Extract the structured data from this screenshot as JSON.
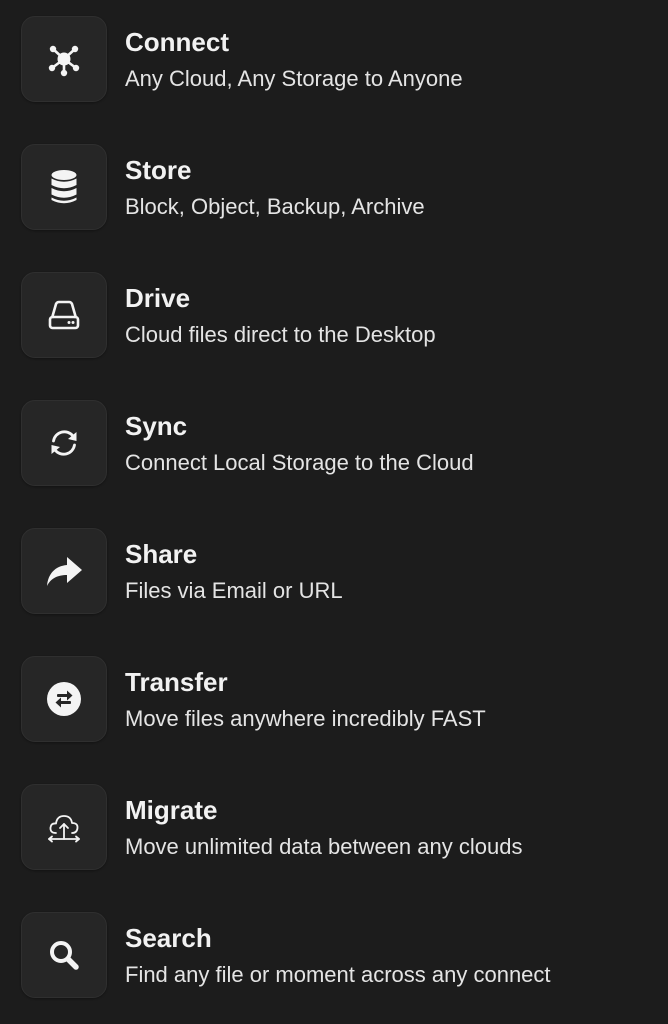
{
  "menu": {
    "items": [
      {
        "icon": "network-hub-icon",
        "title": "Connect",
        "subtitle": "Any Cloud, Any Storage to Anyone"
      },
      {
        "icon": "database-icon",
        "title": "Store",
        "subtitle": "Block, Object, Backup, Archive"
      },
      {
        "icon": "hard-drive-icon",
        "title": "Drive",
        "subtitle": "Cloud files direct to the Desktop"
      },
      {
        "icon": "sync-arrows-icon",
        "title": "Sync",
        "subtitle": "Connect Local Storage to the Cloud"
      },
      {
        "icon": "share-arrow-icon",
        "title": "Share",
        "subtitle": "Files via Email or URL"
      },
      {
        "icon": "transfer-exchange-icon",
        "title": "Transfer",
        "subtitle": "Move files anywhere incredibly FAST"
      },
      {
        "icon": "cloud-upload-icon",
        "title": "Migrate",
        "subtitle": "Move unlimited data between any clouds"
      },
      {
        "icon": "search-icon",
        "title": "Search",
        "subtitle": "Find any file or moment across any connect"
      }
    ]
  },
  "colors": {
    "background": "#1c1c1c",
    "tile": "#262626",
    "icon": "#f4f4f4",
    "text": "#ececec"
  }
}
